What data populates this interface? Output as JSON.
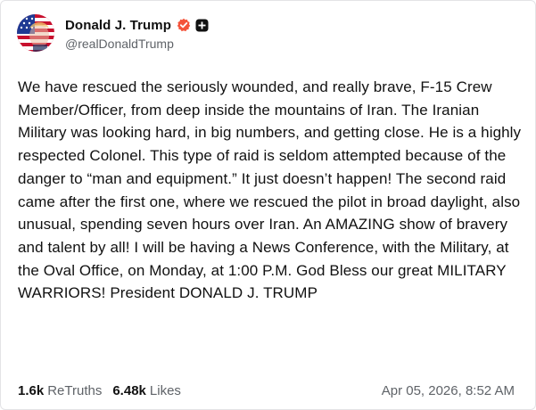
{
  "author": {
    "display_name": "Donald J. Trump",
    "handle": "@realDonaldTrump",
    "avatar_icon": "flag-portrait-avatar",
    "verified_icon": "verified-badge-icon",
    "plus_icon": "plus-badge-icon"
  },
  "post": {
    "text": "We have rescued the seriously wounded, and really brave, F-15 Crew Member/Officer, from deep inside the mountains of Iran. The Iranian Military was looking hard, in big numbers, and getting close. He is a highly respected Colonel. This type of raid is seldom attempted because of the danger to “man and equipment.” It just doesn’t happen! The second raid came after the first one, where we rescued the pilot in broad daylight, also unusual, spending seven hours over Iran. An AMAZING show of bravery and talent by all! I will be having a News Conference, with the Military, at the Oval Office, on Monday, at 1:00 P.M. God Bless our great MILITARY WARRIORS! President DONALD J. TRUMP"
  },
  "stats": {
    "retruths_count": "1.6k",
    "retruths_label": "ReTruths",
    "likes_count": "6.48k",
    "likes_label": "Likes"
  },
  "timestamp": "Apr 05, 2026, 8:52 AM",
  "colors": {
    "verified": "#f4533a",
    "text": "#111111",
    "muted": "#5f6368"
  }
}
